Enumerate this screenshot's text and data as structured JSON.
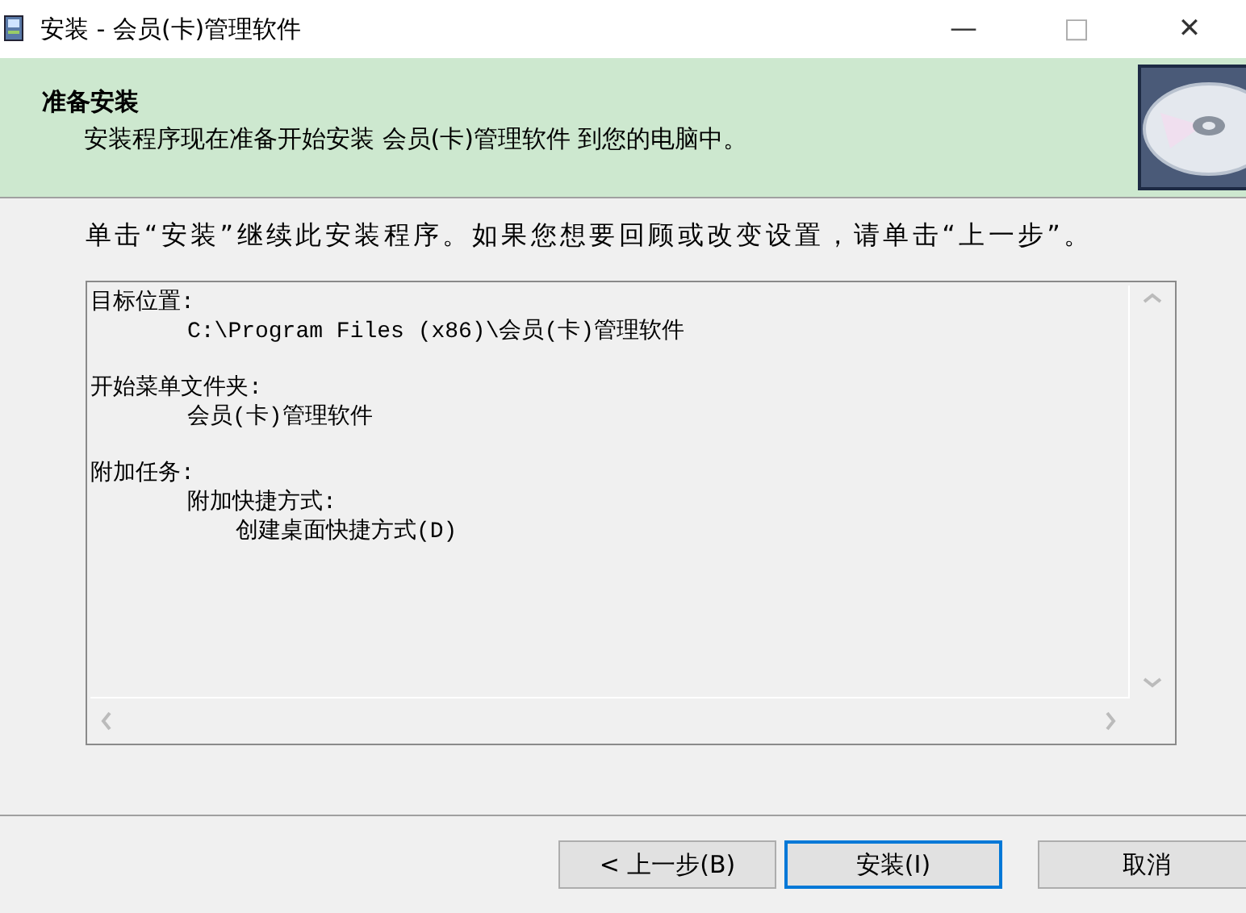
{
  "window": {
    "title": "安装 - 会员(卡)管理软件",
    "controls": [
      "—",
      "□",
      "✕"
    ]
  },
  "header": {
    "title": "准备安装",
    "subtitle": "安装程序现在准备开始安装 会员(卡)管理软件 到您的电脑中。"
  },
  "instruction": "单击“安装”继续此安装程序。如果您想要回顾或改变设置，请单击“上一步”。",
  "memo": {
    "sections": [
      {
        "text": "目标位置:",
        "children": [
          {
            "text": "C:\\Program Files (x86)\\会员(卡)管理软件"
          }
        ]
      },
      {
        "text": "开始菜单文件夹:",
        "children": [
          {
            "text": "会员(卡)管理软件"
          }
        ]
      },
      {
        "text": "附加任务:",
        "children": [
          {
            "text": "附加快捷方式:",
            "children": [
              {
                "text": "创建桌面快捷方式(D)"
              }
            ]
          }
        ]
      }
    ]
  },
  "buttons": [
    {
      "label": "< 上一步(B)",
      "focused": false
    },
    {
      "label": "安装(I)",
      "focused": true
    },
    {
      "label": "取消",
      "focused": false
    }
  ]
}
